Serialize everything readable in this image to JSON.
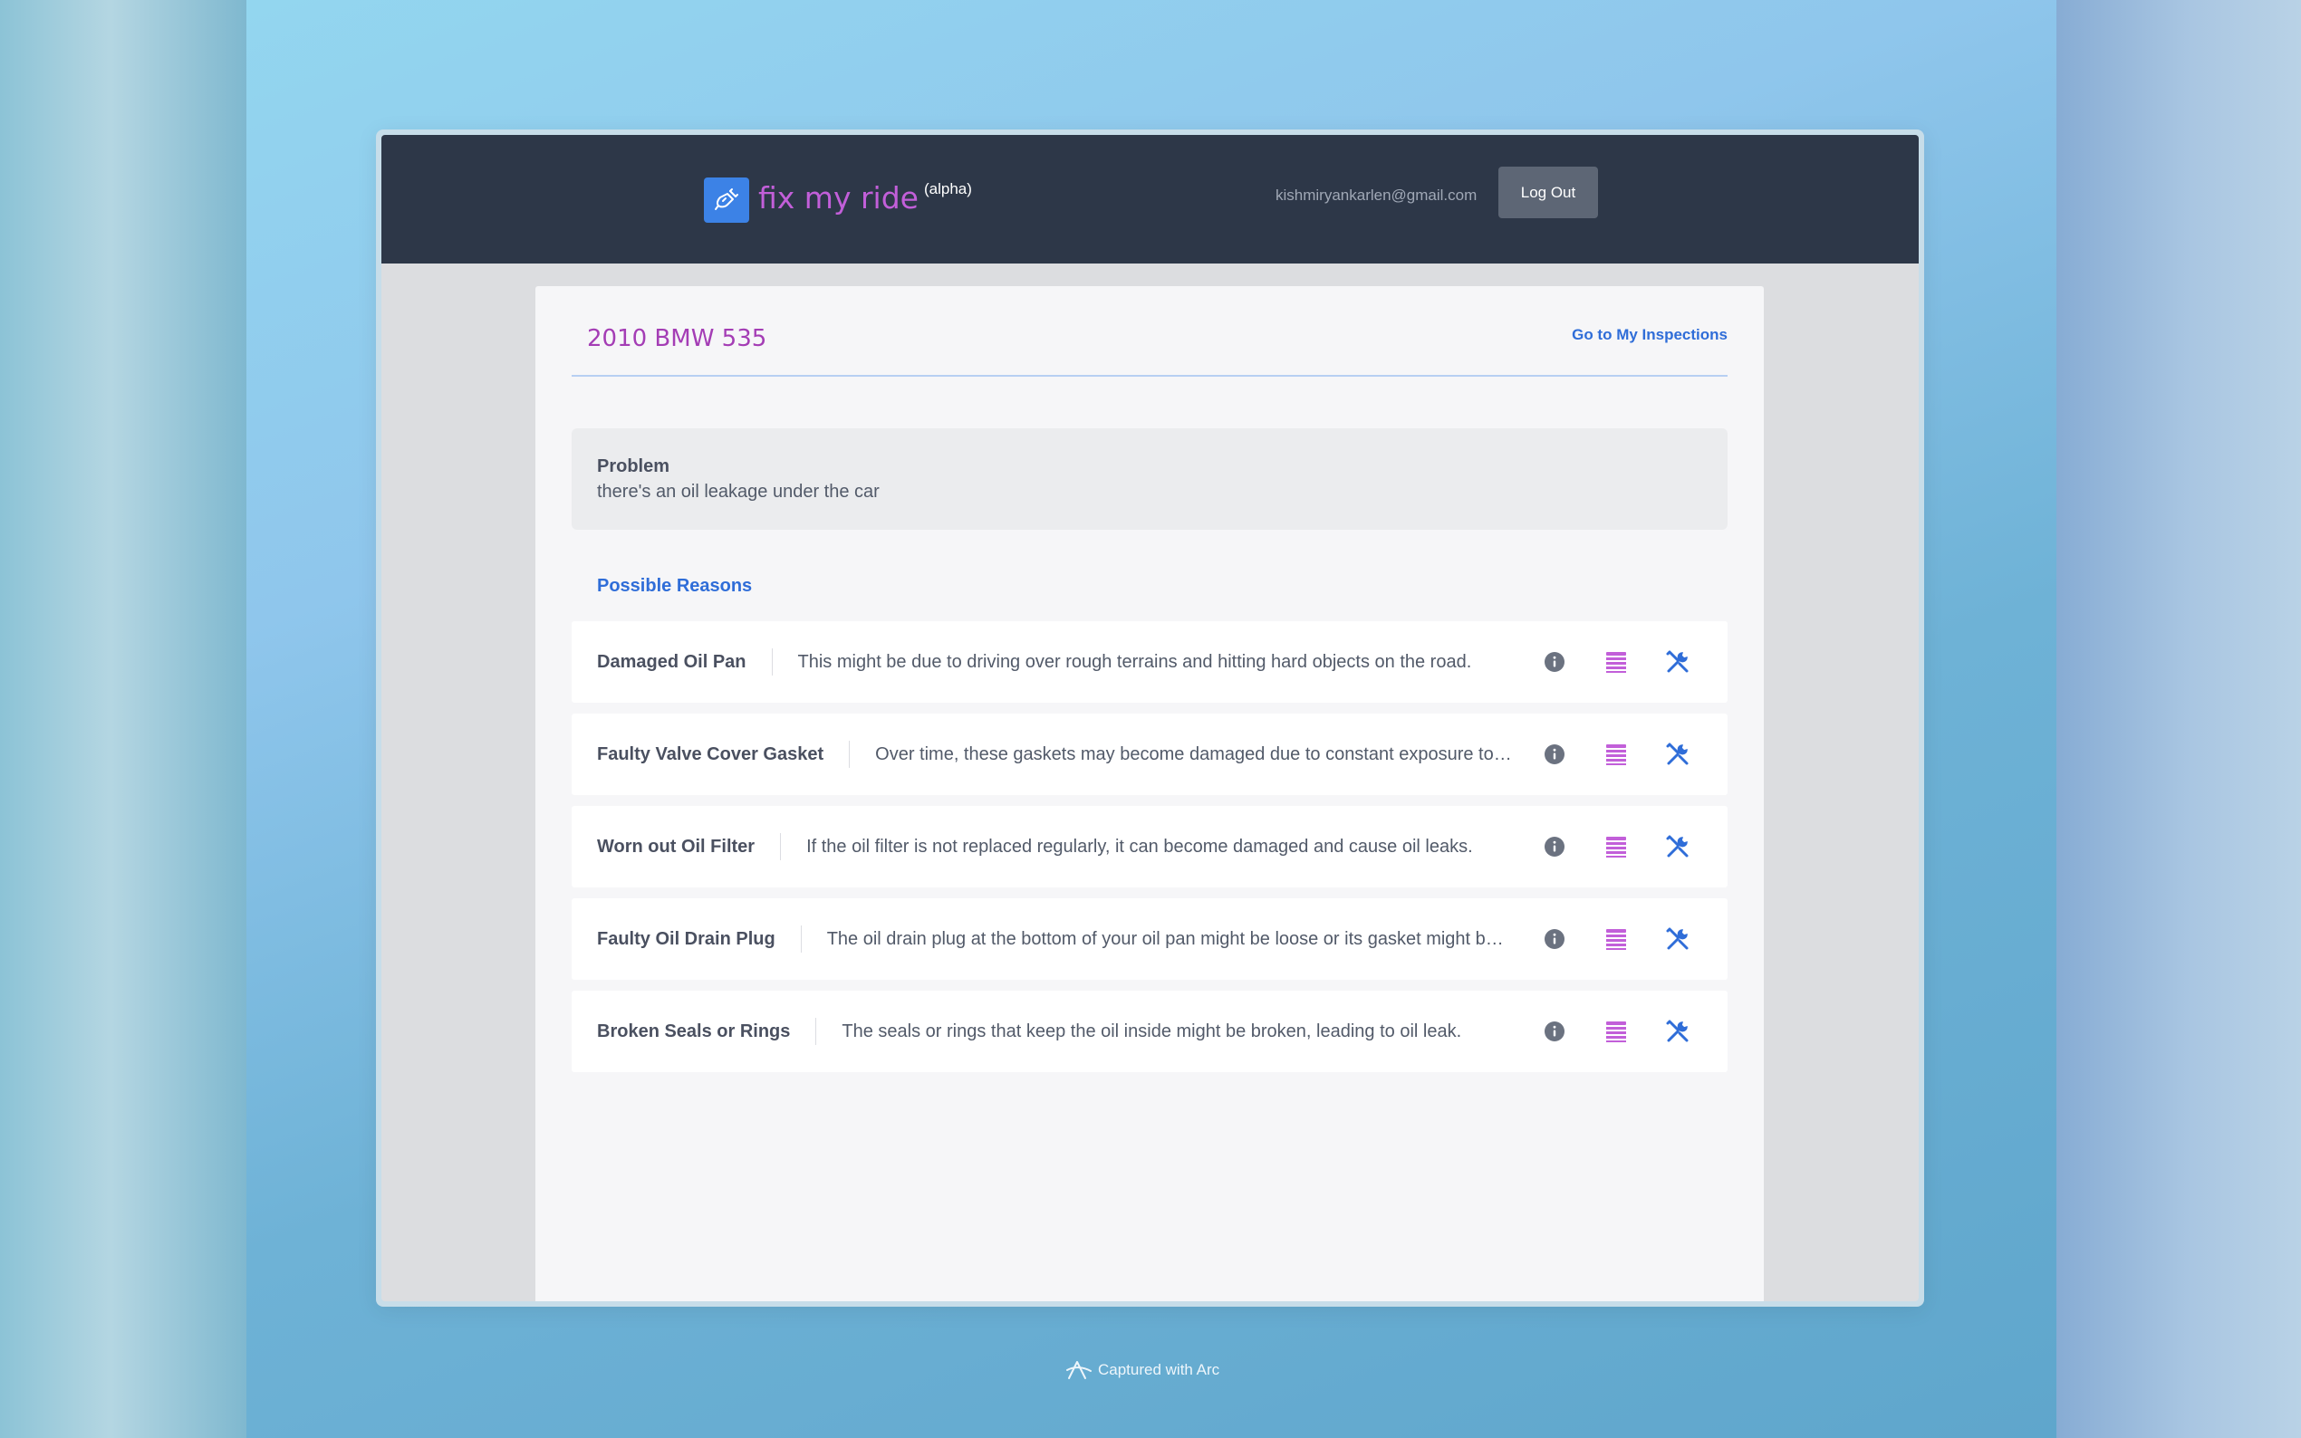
{
  "app": {
    "brand_name": "fix my ride",
    "brand_tag": "(alpha)",
    "logo_icon": "wrench-plug-icon"
  },
  "navbar": {
    "user_email": "kishmiryankarlen@gmail.com",
    "logout_label": "Log Out"
  },
  "page": {
    "car_title": "2010 BMW 535",
    "inspections_link": "Go to My Inspections"
  },
  "problem": {
    "label": "Problem",
    "text": "there's an oil leakage under the car"
  },
  "reasons": {
    "title": "Possible Reasons",
    "items": [
      {
        "name": "Damaged Oil Pan",
        "description": "This might be due to driving over rough terrains and hitting hard objects on the road."
      },
      {
        "name": "Faulty Valve Cover Gasket",
        "description": "Over time, these gaskets may become damaged due to constant exposure to…"
      },
      {
        "name": "Worn out Oil Filter",
        "description": "If the oil filter is not replaced regularly, it can become damaged and cause oil leaks."
      },
      {
        "name": "Faulty Oil Drain Plug",
        "description": "The oil drain plug at the bottom of your oil pan might be loose or its gasket might b…"
      },
      {
        "name": "Broken Seals or Rings",
        "description": "The seals or rings that keep the oil inside might be broken, leading to oil leak."
      }
    ],
    "action_icons": [
      "info-icon",
      "list-icon",
      "tools-icon"
    ]
  },
  "footer": {
    "capture_note": "Captured with Arc"
  },
  "colors": {
    "navbar": "#2d3748",
    "accent_blue": "#2f6dd8",
    "brand_purple": "#c25fd9",
    "title_purple": "#a43db5"
  }
}
